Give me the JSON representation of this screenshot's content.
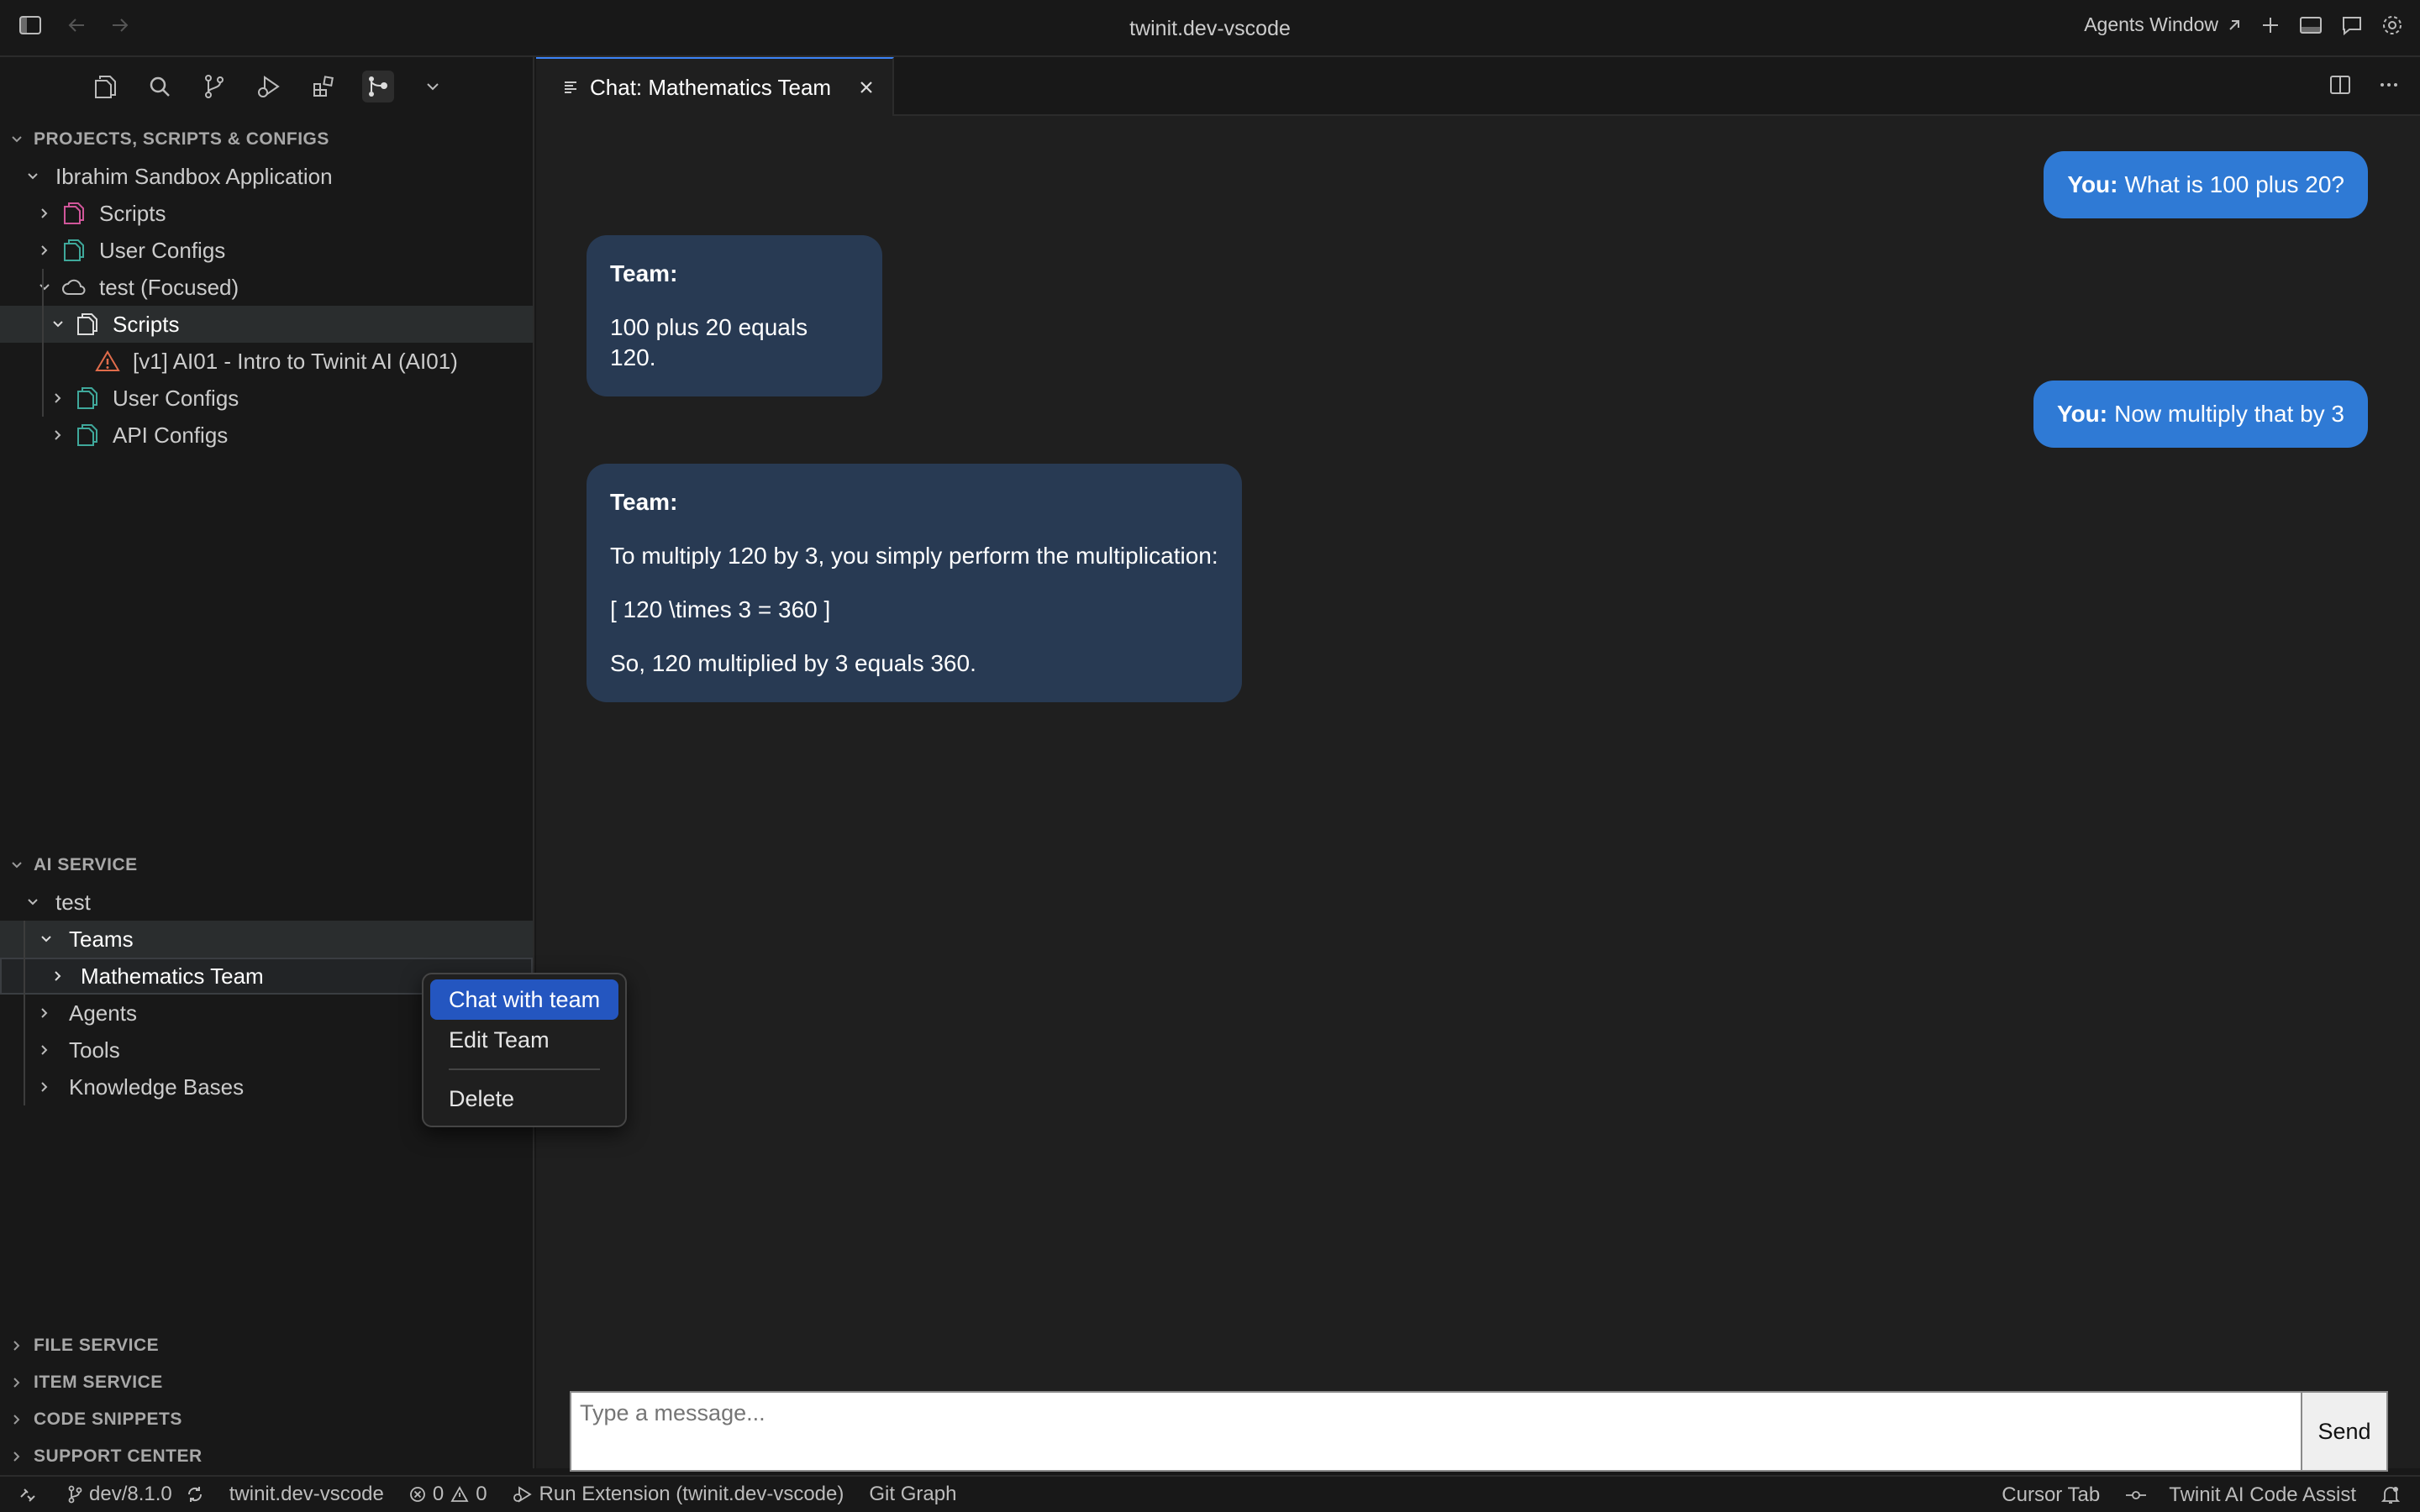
{
  "window": {
    "title": "twinit.dev-vscode",
    "agents_window_label": "Agents Window"
  },
  "sidebar": {
    "projects_section": {
      "title": "PROJECTS, SCRIPTS & CONFIGS",
      "app_name": "Ibrahim Sandbox Application",
      "items": [
        "Scripts",
        "User Configs",
        "test (Focused)",
        "Scripts",
        "[v1] AI01 - Intro to Twinit AI (AI01)",
        "User Configs",
        "API Configs"
      ]
    },
    "ai_section": {
      "title": "AI SERVICE",
      "root": "test",
      "items": [
        "Teams",
        "Mathematics Team",
        "Agents",
        "Tools",
        "Knowledge Bases"
      ]
    },
    "collapsed_sections": [
      "FILE SERVICE",
      "ITEM SERVICE",
      "CODE SNIPPETS",
      "SUPPORT CENTER"
    ]
  },
  "editor": {
    "tab_label": "Chat: Mathematics Team"
  },
  "chat": {
    "user_prefix": "You:",
    "team_prefix": "Team:",
    "messages": [
      {
        "role": "user",
        "text": "What is 100 plus 20?"
      },
      {
        "role": "team",
        "lines": [
          "100 plus 20 equals 120."
        ]
      },
      {
        "role": "user",
        "text": "Now multiply that by 3"
      },
      {
        "role": "team",
        "lines": [
          "To multiply 120 by 3, you simply perform the multiplication:",
          "[ 120 \\times 3 = 360 ]",
          "So, 120 multiplied by 3 equals 360."
        ]
      }
    ],
    "input_placeholder": "Type a message...",
    "send_label": "Send"
  },
  "context_menu": {
    "items": [
      "Chat with team",
      "Edit Team",
      "Delete"
    ]
  },
  "statusbar": {
    "branch": "dev/8.1.0",
    "workspace": "twinit.dev-vscode",
    "errors": "0",
    "warnings": "0",
    "run_extension": "Run Extension (twinit.dev-vscode)",
    "git_graph": "Git Graph",
    "cursor_tab": "Cursor Tab",
    "code_assist": "Twinit AI Code Assist"
  },
  "colors": {
    "accent": "#2f7ad5",
    "team_bubble": "#283a53",
    "menu_highlight": "#2456c0",
    "scripts_icon": "#d0569a",
    "config_icon": "#3fa89b",
    "warning_icon": "#e06c4b"
  }
}
